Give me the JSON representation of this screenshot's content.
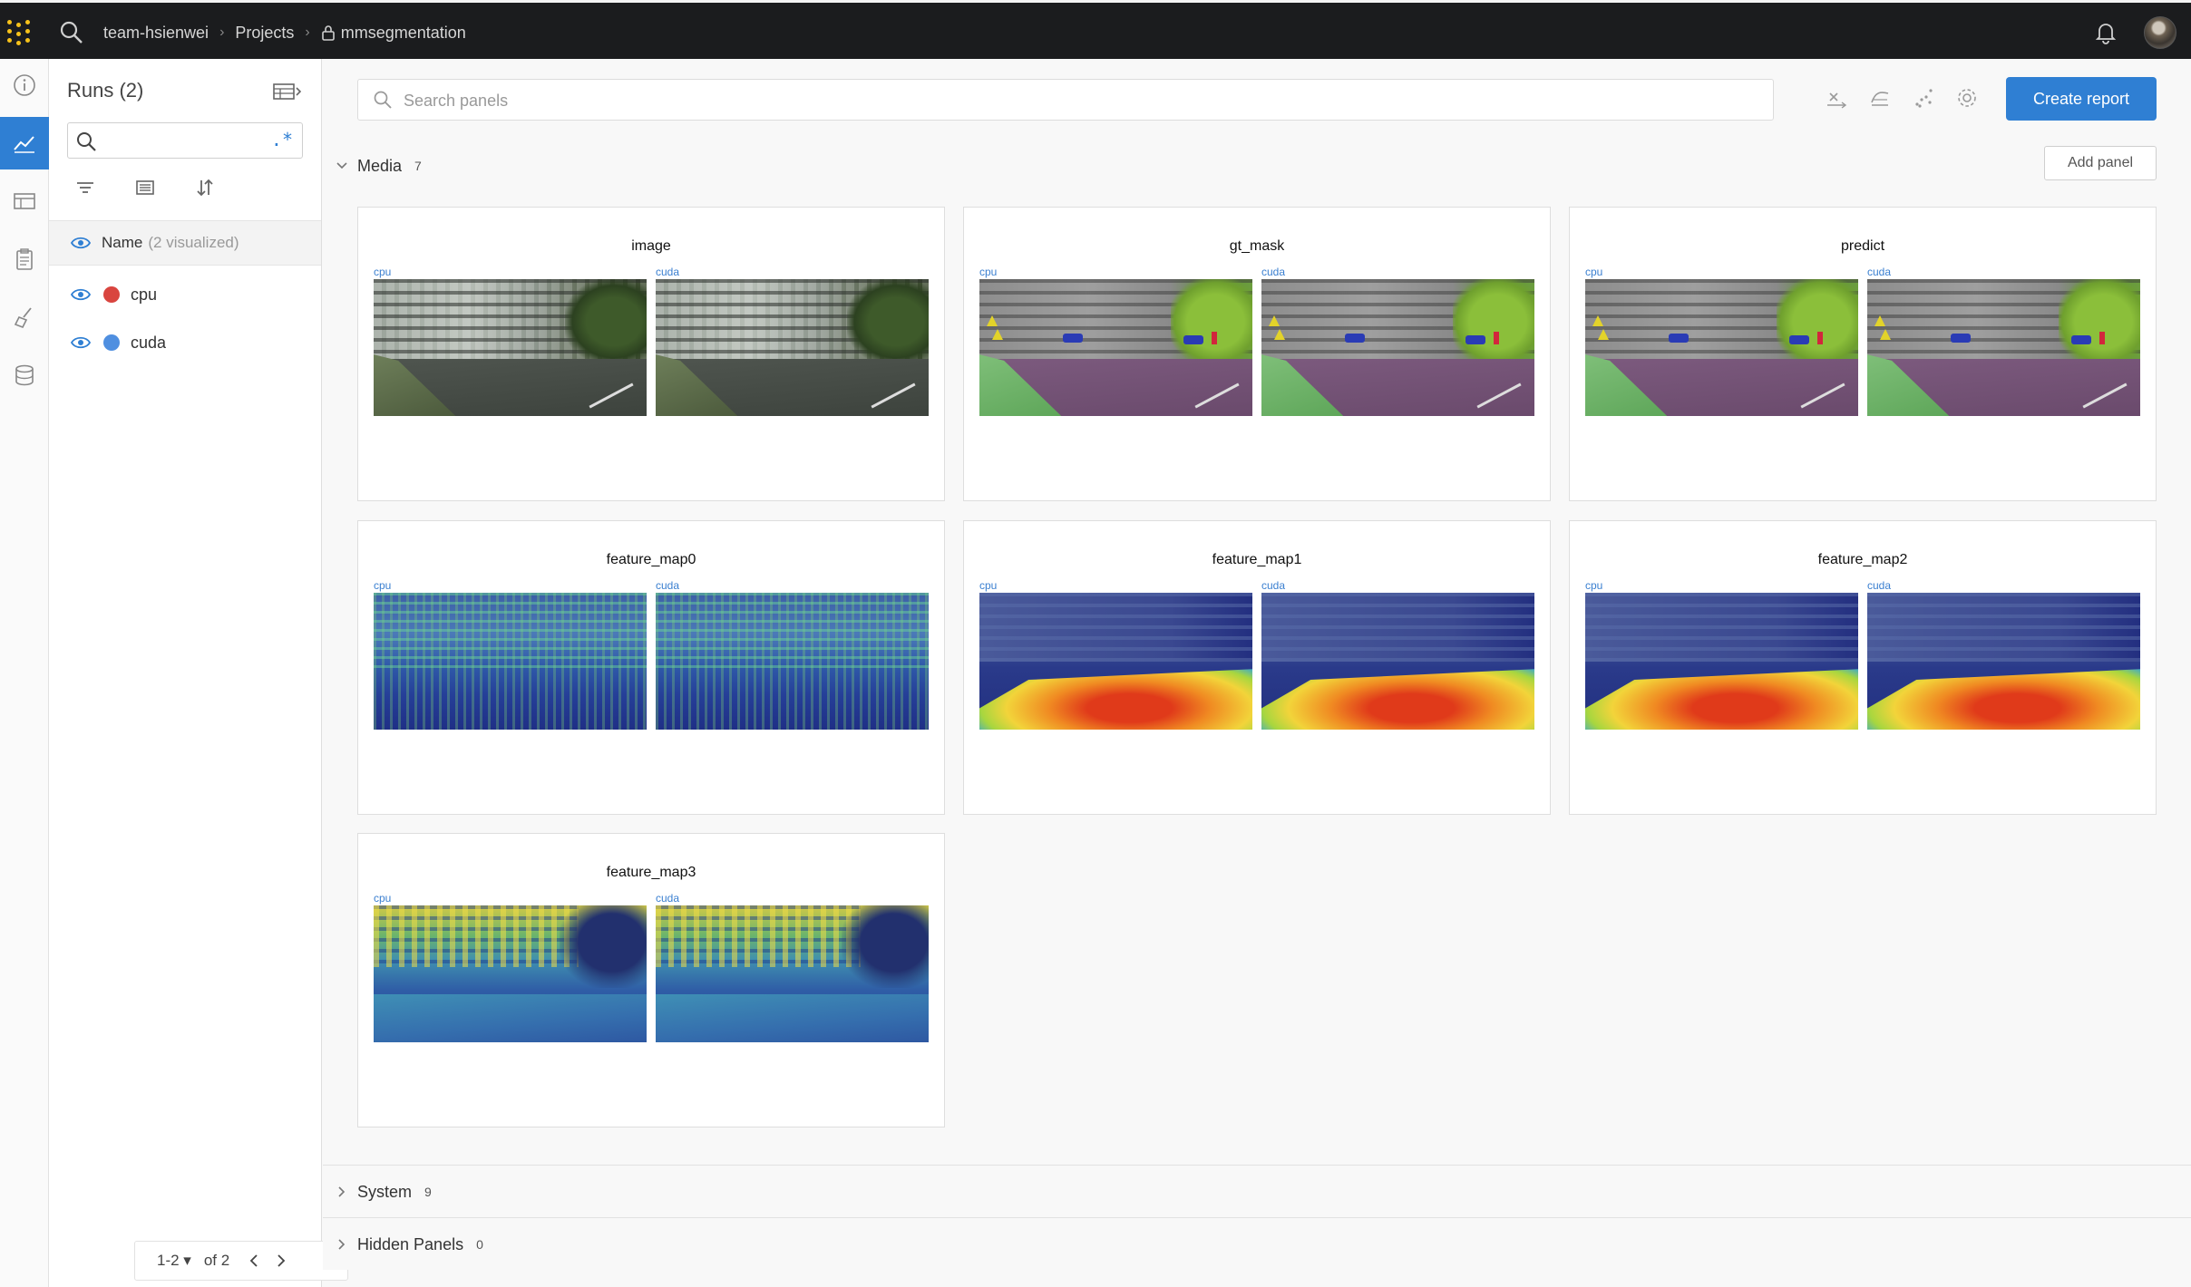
{
  "breadcrumb": {
    "team": "team-hsienwei",
    "projects": "Projects",
    "project": "mmsegmentation"
  },
  "runs_sidebar": {
    "title": "Runs (2)",
    "name_header": "Name",
    "name_sub": "(2 visualized)",
    "regex_symbol": ".*",
    "runs": [
      {
        "name": "cpu",
        "color": "#d9453f"
      },
      {
        "name": "cuda",
        "color": "#4f8fe0"
      }
    ],
    "pager": {
      "range": "1-2",
      "of": "of 2"
    }
  },
  "toolbar": {
    "search_placeholder": "Search panels",
    "create_report": "Create report",
    "add_panel": "Add panel"
  },
  "sections": {
    "media": {
      "name": "Media",
      "count": "7"
    },
    "system": {
      "name": "System",
      "count": "9"
    },
    "hidden": {
      "name": "Hidden Panels",
      "count": "0"
    }
  },
  "panels": [
    {
      "title": "image",
      "left_run": "cpu",
      "right_run": "cuda",
      "kind": "rgb"
    },
    {
      "title": "gt_mask",
      "left_run": "cpu",
      "right_run": "cuda",
      "kind": "segmentation"
    },
    {
      "title": "predict",
      "left_run": "cpu",
      "right_run": "cuda",
      "kind": "segmentation"
    },
    {
      "title": "feature_map0",
      "left_run": "cpu",
      "right_run": "cuda",
      "kind": "heatmap"
    },
    {
      "title": "feature_map1",
      "left_run": "cpu",
      "right_run": "cuda",
      "kind": "heatmap"
    },
    {
      "title": "feature_map2",
      "left_run": "cpu",
      "right_run": "cuda",
      "kind": "heatmap"
    },
    {
      "title": "feature_map3",
      "left_run": "cpu",
      "right_run": "cuda",
      "kind": "heatmap"
    }
  ],
  "colors": {
    "accent": "#2f7fd3",
    "topbar": "#1b1c1e",
    "logo": "#f7c21a"
  }
}
